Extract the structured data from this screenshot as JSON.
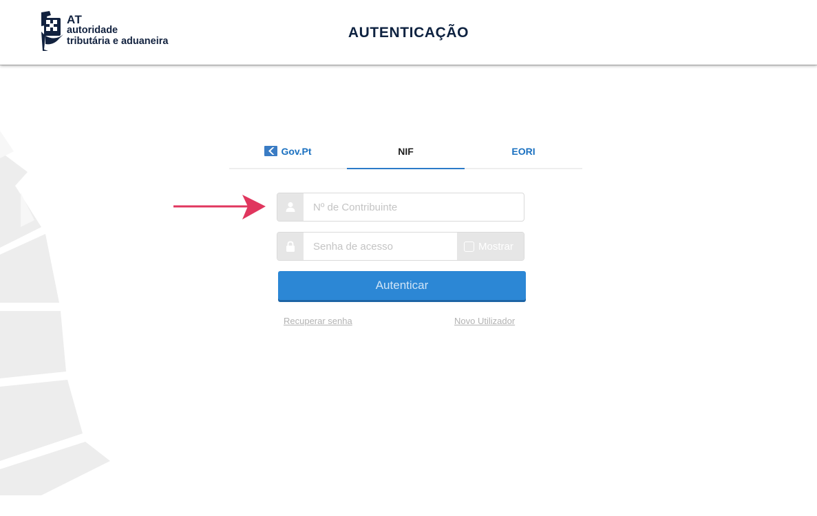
{
  "header": {
    "title": "AUTENTICAÇÃO",
    "logo": {
      "abbr": "AT",
      "line1": "autoridade",
      "line2": "tributária e aduaneira",
      "icon": "at-emblem-icon"
    }
  },
  "tabs": [
    {
      "label": "Gov.Pt",
      "icon": "gov-pt-icon",
      "active": false
    },
    {
      "label": "NIF",
      "active": true
    },
    {
      "label": "EORI",
      "active": false
    }
  ],
  "form": {
    "nif": {
      "placeholder": "Nº de Contribuinte",
      "value": "",
      "icon": "user-icon"
    },
    "password": {
      "placeholder": "Senha de acesso",
      "value": "",
      "icon": "lock-icon"
    },
    "show_password": {
      "label": "Mostrar",
      "checked": false
    },
    "submit_label": "Autenticar",
    "recover_label": "Recuperar senha",
    "new_user_label": "Novo Utilizador"
  },
  "colors": {
    "brand_dark": "#0e2240",
    "accent": "#2c87d5",
    "tab_link": "#1a70c0",
    "annotation_arrow": "#e0365e"
  }
}
